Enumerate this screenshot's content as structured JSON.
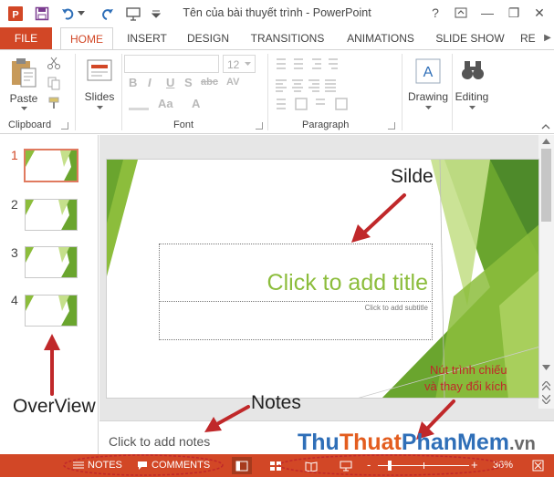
{
  "window": {
    "title": "Tên của bài thuyết trình - PowerPoint",
    "minimize_glyph": "—",
    "restore_glyph": "❐",
    "close_glyph": "✕",
    "help_glyph": "?"
  },
  "tabs": [
    {
      "label": "FILE"
    },
    {
      "label": "HOME"
    },
    {
      "label": "INSERT"
    },
    {
      "label": "DESIGN"
    },
    {
      "label": "TRANSITIONS"
    },
    {
      "label": "ANIMATIONS"
    },
    {
      "label": "SLIDE SHOW"
    },
    {
      "label": "RE"
    }
  ],
  "ribbon": {
    "paste_label": "Paste",
    "slides_label": "Slides",
    "font_size_value": "12",
    "drawing_label": "Drawing",
    "editing_label": "Editing",
    "groups": {
      "clipboard": "Clipboard",
      "font": "Font",
      "paragraph": "Paragraph"
    },
    "format_buttons": [
      "B",
      "I",
      "U",
      "S",
      "abc",
      "AV",
      "Aa",
      "A"
    ]
  },
  "thumbnails": [
    {
      "number": "1",
      "selected": true
    },
    {
      "number": "2",
      "selected": false
    },
    {
      "number": "3",
      "selected": false
    },
    {
      "number": "4",
      "selected": false
    }
  ],
  "slide": {
    "title_placeholder": "Click to add title",
    "subtitle_placeholder": "Click to add subtitle",
    "accent_color": "#8cbd3c"
  },
  "notes": {
    "placeholder": "Click to add notes"
  },
  "statusbar": {
    "notes_label": "NOTES",
    "comments_label": "COMMENTS",
    "zoom_level": "36%",
    "zoom_minus": "-",
    "zoom_plus": "+",
    "color": "#d24726"
  },
  "annotations": {
    "slide_label": "Silde",
    "overview_label": "OverView",
    "notes_label": "Notes",
    "views_label_line1": "Nút trình chiếu",
    "views_label_line2": "và thay đổi kích"
  },
  "watermark": {
    "part1": "Thu",
    "part2": "Thuat",
    "part3": "PhanMem",
    "part4": ".vn"
  }
}
